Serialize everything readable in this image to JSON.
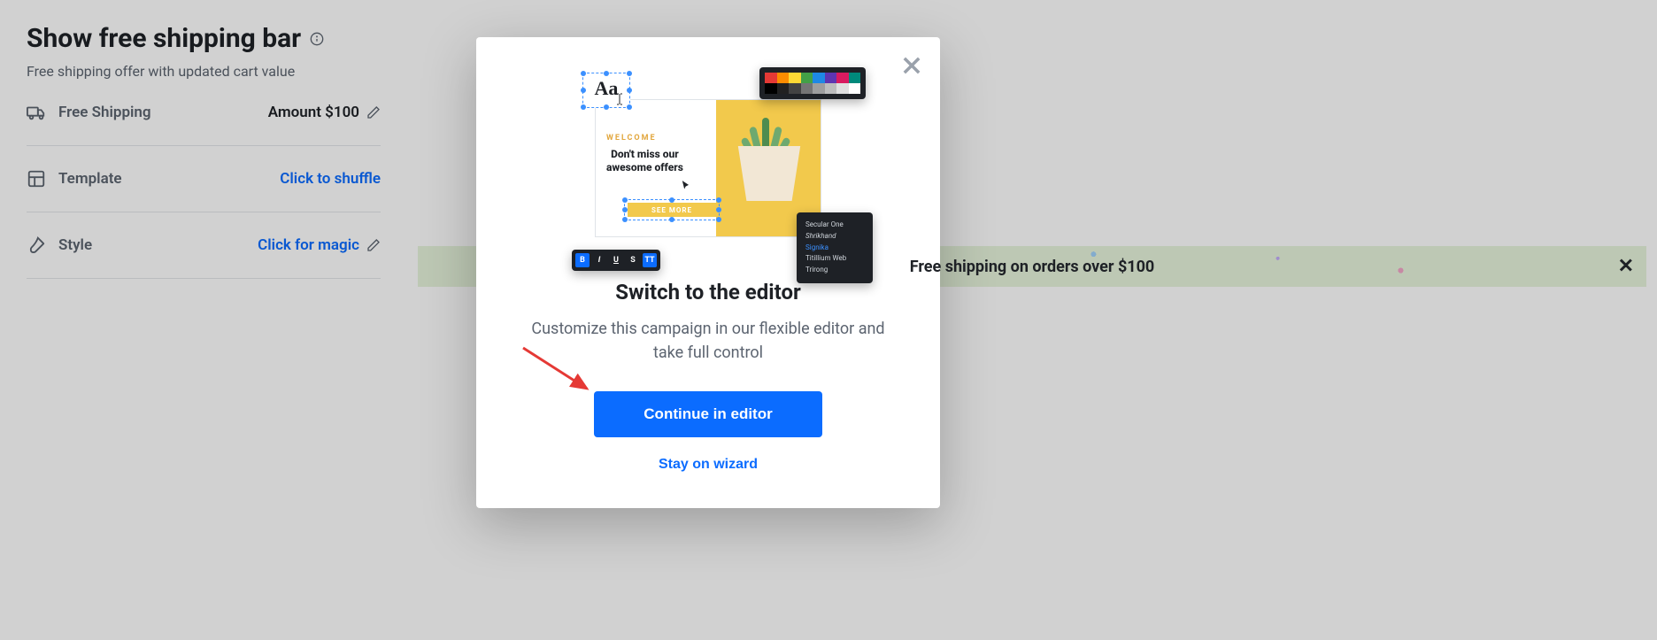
{
  "sidebar": {
    "title": "Show free shipping bar",
    "subtitle": "Free shipping offer with updated cart value",
    "rows": {
      "free_shipping": {
        "label": "Free Shipping",
        "value": "Amount $100"
      },
      "template": {
        "label": "Template",
        "value": "Click to shuffle"
      },
      "style": {
        "label": "Style",
        "value": "Click for magic"
      }
    }
  },
  "preview": {
    "shipping_bar_text": "Free shipping on orders over $100"
  },
  "modal": {
    "title": "Switch to the editor",
    "body": "Customize this campaign in our flexible editor and take full control",
    "primary_label": "Continue in editor",
    "secondary_label": "Stay on wizard",
    "illustration": {
      "aa": "Aa",
      "welcome": "WELCOME",
      "headline": "Don't miss our awesome offers",
      "button": "SEE MORE",
      "fonts": [
        "Secular One",
        "Shrikhand",
        "Signika",
        "Titillium Web",
        "Trirong"
      ],
      "format_buttons": [
        "B",
        "I",
        "U",
        "S",
        "TT"
      ]
    }
  }
}
